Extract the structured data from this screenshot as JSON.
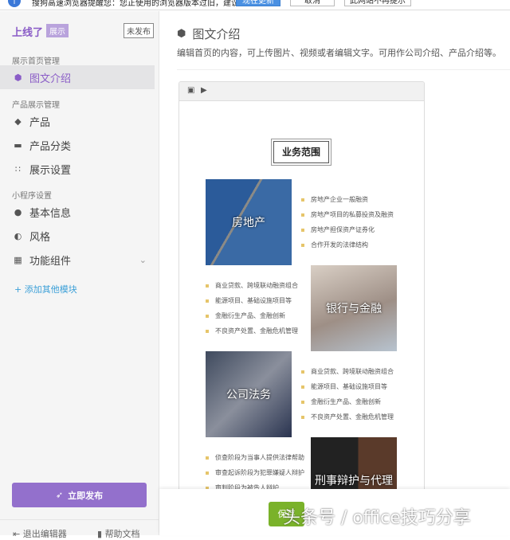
{
  "browser_bar": {
    "message": "搜狗高速浏览器提醒您：您正使用的浏览器版本过旧，建议更新：",
    "buttons": [
      "现在更新",
      "取消",
      "此网站不再提示"
    ]
  },
  "sidebar": {
    "logo": "上线了",
    "logo_badge": "展示",
    "status": "未发布",
    "sections": [
      {
        "title": "展示首页管理",
        "items": [
          {
            "label": "图文介绍",
            "icon": "cube-icon",
            "active": true
          }
        ]
      },
      {
        "title": "产品展示管理",
        "items": [
          {
            "label": "产品",
            "icon": "tag-icon"
          },
          {
            "label": "产品分类",
            "icon": "folder-icon"
          },
          {
            "label": "展示设置",
            "icon": "grid-icon"
          }
        ]
      },
      {
        "title": "小程序设置",
        "items": [
          {
            "label": "基本信息",
            "icon": "info-icon"
          },
          {
            "label": "风格",
            "icon": "palette-icon"
          },
          {
            "label": "功能组件",
            "icon": "apps-icon"
          }
        ]
      }
    ],
    "add_module": "+ 添加其他模块",
    "publish": "立即发布",
    "exit": "退出编辑器",
    "help": "帮助文档"
  },
  "main": {
    "title": "图文介绍",
    "description": "编辑首页的内容，可上传图片、视频或者编辑文字。可用作公司介绍、产品介绍等。",
    "editor": {
      "heading": "业务范围",
      "blocks": [
        {
          "image_label": "房地产",
          "items": [
            "房地产企业一般融资",
            "房地产项目的私募投资及融资",
            "房地产担保资产证券化",
            "合作开发的法律结构"
          ]
        },
        {
          "image_label": "银行与金融",
          "items": [
            "商业贷款、跨境联动融资组合",
            "能源项目、基础设施项目等",
            "金融衍生产品、金融创新",
            "不良资产处置、金融危机管理"
          ]
        },
        {
          "image_label": "公司法务",
          "items": [
            "商业贷款、跨境联动融资组合",
            "能源项目、基础设施项目等",
            "金融衍生产品、金融创新",
            "不良资产处置、金融危机管理"
          ]
        },
        {
          "image_label": "刑事辩护与代理",
          "items": [
            "侦查阶段为当事人提供法律帮助",
            "审查起诉阶段为犯罪嫌疑人辩护",
            "审判阶段为被告人辩护"
          ]
        }
      ]
    },
    "save": "保存"
  },
  "watermark": "头条号 / office技巧分享",
  "colors": {
    "accent": "#9370cc",
    "save": "#7ab22a",
    "link": "#3ca0d8"
  }
}
